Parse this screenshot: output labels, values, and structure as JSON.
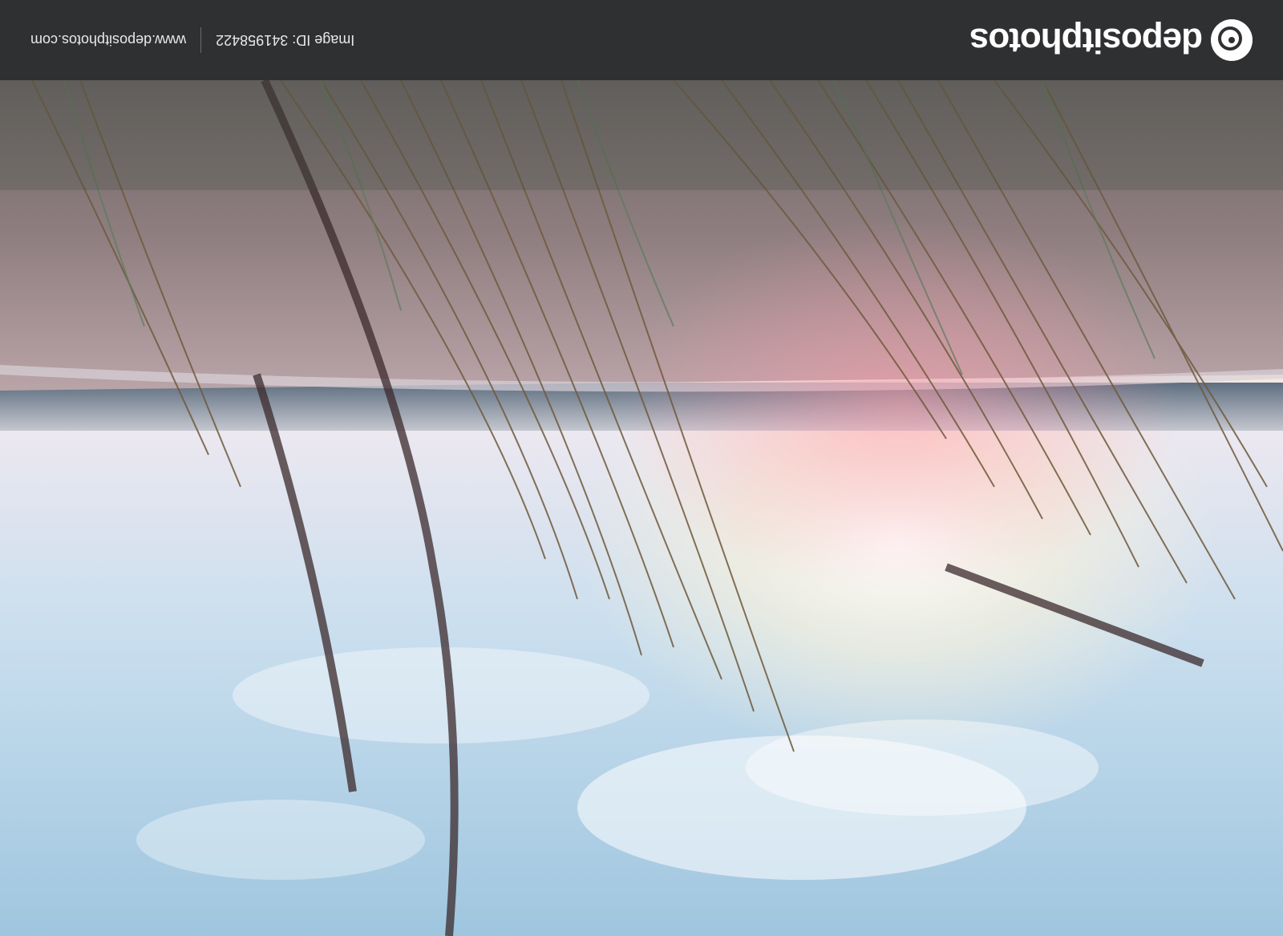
{
  "footer": {
    "brand_name": "depositphotos",
    "image_id": "Image ID: 341958422",
    "website": "www.depositphotos.com"
  },
  "photo": {
    "watermark_text": "depositphotos",
    "orientation": "upside-down",
    "subject": "grass stems against sky with sea and beach"
  },
  "colors": {
    "footer_bg": "#2f3032",
    "footer_text": "#ffffff"
  }
}
